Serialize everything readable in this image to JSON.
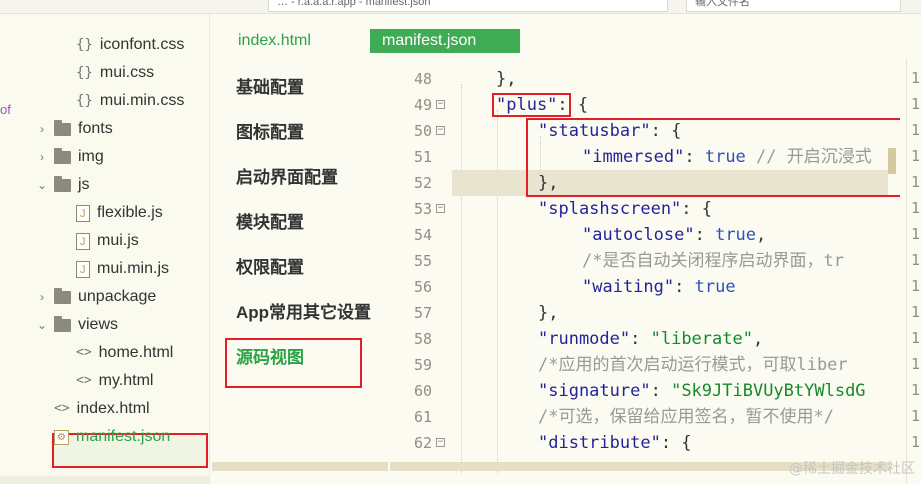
{
  "topbar": {
    "tabs": [
      "… - r.a.a.a.r.app - manifest.json",
      "输入文件名"
    ]
  },
  "tree": {
    "side_mark": "of",
    "items": [
      {
        "label": "iconfont.css",
        "kind": "css",
        "indent": 2,
        "chev": ""
      },
      {
        "label": "mui.css",
        "kind": "css",
        "indent": 2,
        "chev": ""
      },
      {
        "label": "mui.min.css",
        "kind": "css",
        "indent": 2,
        "chev": ""
      },
      {
        "label": "fonts",
        "kind": "folder",
        "indent": 1,
        "chev": "›"
      },
      {
        "label": "img",
        "kind": "folder",
        "indent": 1,
        "chev": "›"
      },
      {
        "label": "js",
        "kind": "folder",
        "indent": 1,
        "chev": "⌄"
      },
      {
        "label": "flexible.js",
        "kind": "js",
        "indent": 2,
        "chev": ""
      },
      {
        "label": "mui.js",
        "kind": "js",
        "indent": 2,
        "chev": ""
      },
      {
        "label": "mui.min.js",
        "kind": "js",
        "indent": 2,
        "chev": ""
      },
      {
        "label": "unpackage",
        "kind": "folder",
        "indent": 1,
        "chev": "›"
      },
      {
        "label": "views",
        "kind": "folder",
        "indent": 1,
        "chev": "⌄"
      },
      {
        "label": "home.html",
        "kind": "html",
        "indent": 2,
        "chev": ""
      },
      {
        "label": "my.html",
        "kind": "html",
        "indent": 2,
        "chev": ""
      },
      {
        "label": "index.html",
        "kind": "html",
        "indent": 1,
        "chev": ""
      },
      {
        "label": "manifest.json",
        "kind": "json",
        "indent": 1,
        "chev": "",
        "selected": true
      }
    ]
  },
  "editor_tabs": {
    "inactive": "index.html",
    "active": "manifest.json"
  },
  "settings_nav": {
    "items": [
      "基础配置",
      "图标配置",
      "启动界面配置",
      "模块配置",
      "权限配置",
      "App常用其它设置",
      "源码视图"
    ],
    "active_index": 6
  },
  "code": {
    "lines": [
      {
        "n": "48",
        "fold": false,
        "indent": 2,
        "parts": [
          [
            "p",
            "},"
          ]
        ]
      },
      {
        "n": "49",
        "fold": true,
        "indent": 2,
        "parts": [
          [
            "k",
            "\"plus\""
          ],
          [
            "p",
            ": {"
          ]
        ]
      },
      {
        "n": "50",
        "fold": true,
        "indent": 3,
        "parts": [
          [
            "k",
            "\"statusbar\""
          ],
          [
            "p",
            ": {"
          ]
        ]
      },
      {
        "n": "51",
        "fold": false,
        "indent": 4,
        "parts": [
          [
            "k",
            "\"immersed\""
          ],
          [
            "p",
            ": "
          ],
          [
            "b",
            "true"
          ],
          [
            "c",
            " // 开启沉浸式"
          ]
        ]
      },
      {
        "n": "52",
        "fold": false,
        "indent": 3,
        "parts": [
          [
            "p",
            "},"
          ]
        ],
        "current": true
      },
      {
        "n": "53",
        "fold": true,
        "indent": 3,
        "parts": [
          [
            "k",
            "\"splashscreen\""
          ],
          [
            "p",
            ": {"
          ]
        ]
      },
      {
        "n": "54",
        "fold": false,
        "indent": 4,
        "parts": [
          [
            "k",
            "\"autoclose\""
          ],
          [
            "p",
            ": "
          ],
          [
            "b",
            "true"
          ],
          [
            "p",
            ","
          ]
        ]
      },
      {
        "n": "55",
        "fold": false,
        "indent": 4,
        "parts": [
          [
            "c",
            "/*是否自动关闭程序启动界面，tr"
          ]
        ]
      },
      {
        "n": "56",
        "fold": false,
        "indent": 4,
        "parts": [
          [
            "k",
            "\"waiting\""
          ],
          [
            "p",
            ": "
          ],
          [
            "b",
            "true"
          ]
        ]
      },
      {
        "n": "57",
        "fold": false,
        "indent": 3,
        "parts": [
          [
            "p",
            "},"
          ]
        ]
      },
      {
        "n": "58",
        "fold": false,
        "indent": 3,
        "parts": [
          [
            "k",
            "\"runmode\""
          ],
          [
            "p",
            ": "
          ],
          [
            "s",
            "\"liberate\""
          ],
          [
            "p",
            ","
          ]
        ]
      },
      {
        "n": "59",
        "fold": false,
        "indent": 3,
        "parts": [
          [
            "c",
            "/*应用的首次启动运行模式，可取liber"
          ]
        ]
      },
      {
        "n": "60",
        "fold": false,
        "indent": 3,
        "parts": [
          [
            "k",
            "\"signature\""
          ],
          [
            "p",
            ": "
          ],
          [
            "s",
            "\"Sk9JTiBVUyBtYWlsdG"
          ]
        ]
      },
      {
        "n": "61",
        "fold": false,
        "indent": 3,
        "parts": [
          [
            "c",
            "/*可选，保留给应用签名，暂不使用*/"
          ]
        ]
      },
      {
        "n": "62",
        "fold": true,
        "indent": 3,
        "parts": [
          [
            "k",
            "\"distribute\""
          ],
          [
            "p",
            ": {"
          ]
        ]
      }
    ]
  },
  "right_pane_digits": [
    "1",
    "1",
    "1",
    "1",
    "1",
    "1",
    "1",
    "1",
    "1",
    "1",
    "1",
    "1",
    "1",
    "1",
    "1"
  ],
  "watermark": "@稀土掘金技术社区"
}
